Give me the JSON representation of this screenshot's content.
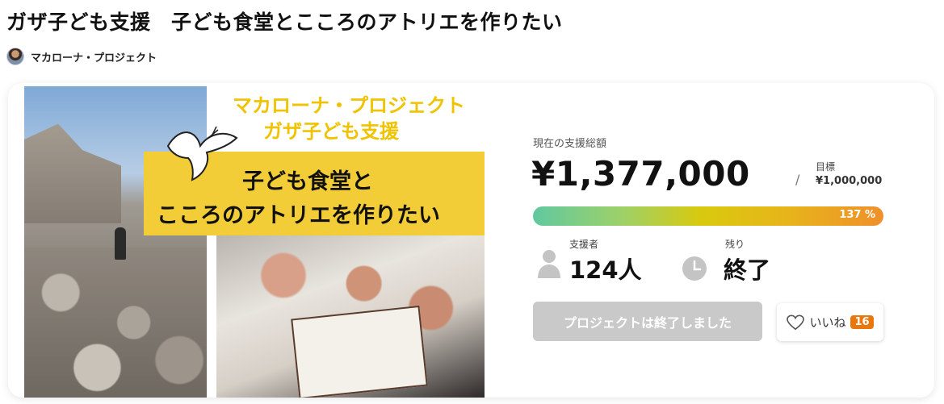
{
  "header": {
    "title": "ガザ子ども支援　子ども食堂とこころのアトリエを作りたい",
    "owner_name": "マカローナ・プロジェクト"
  },
  "hero": {
    "line1": "マカローナ・プロジェクト",
    "line2": "ガザ子ども支援",
    "main_line1": "子ども食堂と",
    "main_line2": "こころのアトリエを作りたい"
  },
  "stats": {
    "total_label": "現在の支援総額",
    "total_amount": "¥1,377,000",
    "slash": "/",
    "goal_label": "目標",
    "goal_amount": "¥1,000,000",
    "progress_text": "137 %",
    "progress_percent": 137,
    "supporters_label": "支援者",
    "supporters_value": "124人",
    "remaining_label": "残り",
    "remaining_value": "終了"
  },
  "actions": {
    "ended_label": "プロジェクトは終了しました",
    "like_label": "いいね",
    "like_count": "16"
  },
  "colors": {
    "accent_orange": "#e9770e",
    "banner_yellow": "#f2cd38",
    "title_yellow": "#f0c300",
    "disabled_gray": "#c9c9c9"
  },
  "icons": [
    "avatar",
    "dove-icon",
    "person-icon",
    "clock-icon",
    "heart-icon"
  ]
}
